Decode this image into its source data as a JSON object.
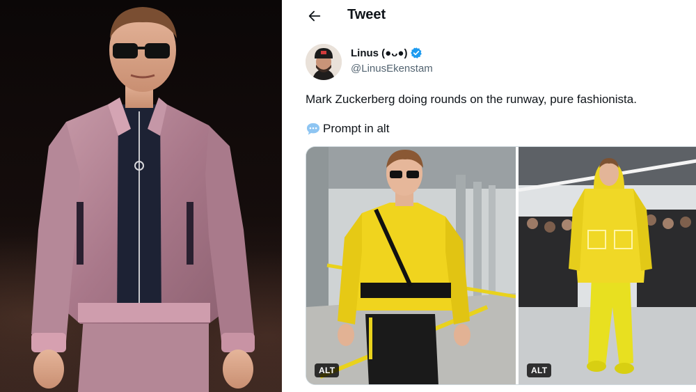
{
  "header": {
    "title": "Tweet",
    "back_icon": "arrow-left-icon"
  },
  "author": {
    "name": "Linus (●ᴗ●)",
    "handle": "@LinusEkenstam",
    "verified": true,
    "verified_color": "#1d9bf0"
  },
  "tweet": {
    "text": "Mark Zuckerberg doing rounds on the runway, pure fashionista.",
    "prompt_icon": "speech-bubble-icon",
    "prompt_text": "Prompt in alt"
  },
  "media": [
    {
      "alt_badge": "ALT",
      "description": "yellow sweater runway"
    },
    {
      "alt_badge": "ALT",
      "description": "yellow hooded jacket runway"
    }
  ],
  "left_image": {
    "subject": "pink metallic bomber jacket on runway"
  }
}
